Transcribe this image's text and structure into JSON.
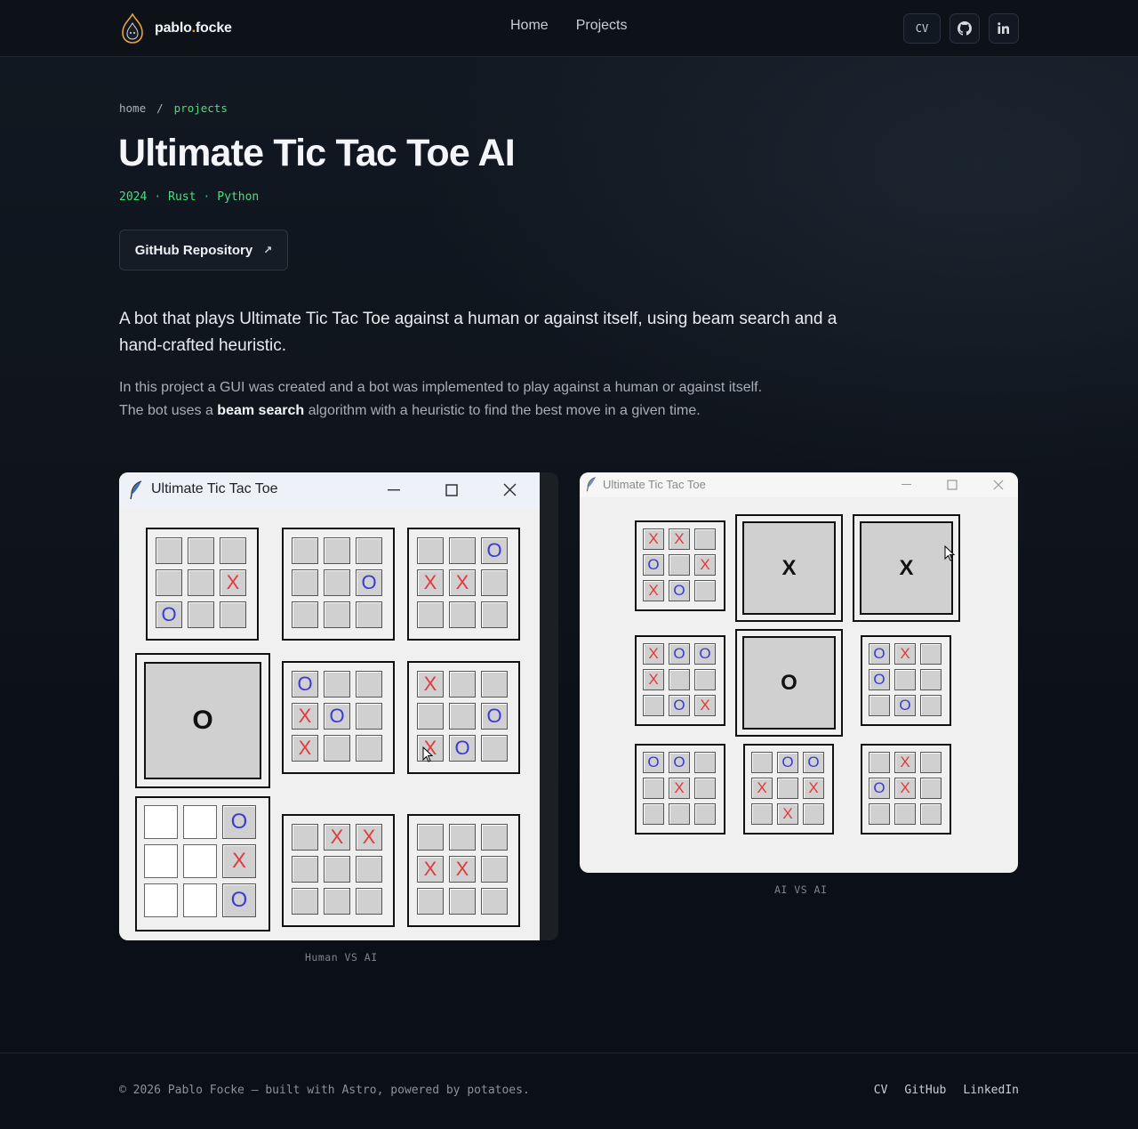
{
  "header": {
    "brand_first": "pablo",
    "brand_dot": ".",
    "brand_last": "focke",
    "nav": [
      "Home",
      "Projects"
    ],
    "cv_label": "CV"
  },
  "breadcrumb": {
    "home": "home",
    "sep": "/",
    "current": "projects"
  },
  "project": {
    "title": "Ultimate Tic Tac Toe AI",
    "year": "2024",
    "sep": "·",
    "tags": [
      "Rust",
      "Python"
    ],
    "repo_button": "GitHub Repository",
    "repo_arrow": "↗",
    "lead": "A bot that plays Ultimate Tic Tac Toe against a human or against itself, using beam search and a hand-crafted heuristic.",
    "body_before": "In this project a GUI was created and a bot was implemented to play against a human or against itself. The bot uses a ",
    "body_bold": "beam search",
    "body_after": " algorithm with a heuristic to find the best move in a given time."
  },
  "screenshots": [
    {
      "window_title": "Ultimate Tic Tac Toe",
      "caption": "Human VS AI",
      "boards": [
        [
          "",
          "",
          "",
          "",
          "",
          "X",
          "O",
          "",
          ""
        ],
        [
          "",
          "",
          "",
          "",
          "",
          "O",
          "",
          "",
          ""
        ],
        [
          "",
          "",
          "O",
          "X",
          "X",
          "",
          "",
          "",
          ""
        ],
        "O",
        [
          "O",
          "",
          "",
          "X",
          "O",
          "",
          "X",
          "",
          ""
        ],
        [
          "X",
          "",
          "",
          "",
          "",
          "O",
          "X",
          "O",
          ""
        ],
        [
          "",
          "",
          "O",
          "",
          "",
          "X",
          "",
          "",
          "O"
        ],
        [
          "",
          "X",
          "X",
          "",
          "",
          "",
          "",
          "",
          ""
        ],
        [
          "",
          "",
          "",
          "X",
          "X",
          "",
          "",
          "",
          ""
        ]
      ]
    },
    {
      "window_title": "Ultimate Tic Tac Toe",
      "caption": "AI VS AI",
      "boards": [
        [
          "X",
          "X",
          "",
          "O",
          "",
          "X",
          "X",
          "O",
          ""
        ],
        "X",
        "X",
        [
          "X",
          "O",
          "O",
          "X",
          "",
          "",
          "",
          "O",
          "X"
        ],
        "O",
        [
          "O",
          "X",
          "",
          "O",
          "",
          "",
          "",
          "O",
          ""
        ],
        [
          "O",
          "O",
          "",
          "",
          "X",
          "",
          "",
          "",
          ""
        ],
        [
          "",
          "O",
          "O",
          "X",
          "",
          "X",
          "",
          "X",
          ""
        ],
        [
          "",
          "X",
          "",
          "O",
          "X",
          "",
          "",
          "",
          ""
        ]
      ]
    }
  ],
  "footer": {
    "copyright": "© 2026 Pablo Focke — built with Astro, powered by potatoes.",
    "links": [
      "CV",
      "GitHub",
      "LinkedIn"
    ]
  },
  "colors": {
    "accent_green": "#4ade80",
    "x_mark": "#e23a3a",
    "o_mark": "#3a3ad6"
  },
  "icons": [
    "flame-logo-icon",
    "github-icon",
    "linkedin-icon",
    "external-arrow-icon",
    "feather-icon",
    "minimize-icon",
    "maximize-icon",
    "close-icon",
    "mouse-cursor-icon"
  ]
}
